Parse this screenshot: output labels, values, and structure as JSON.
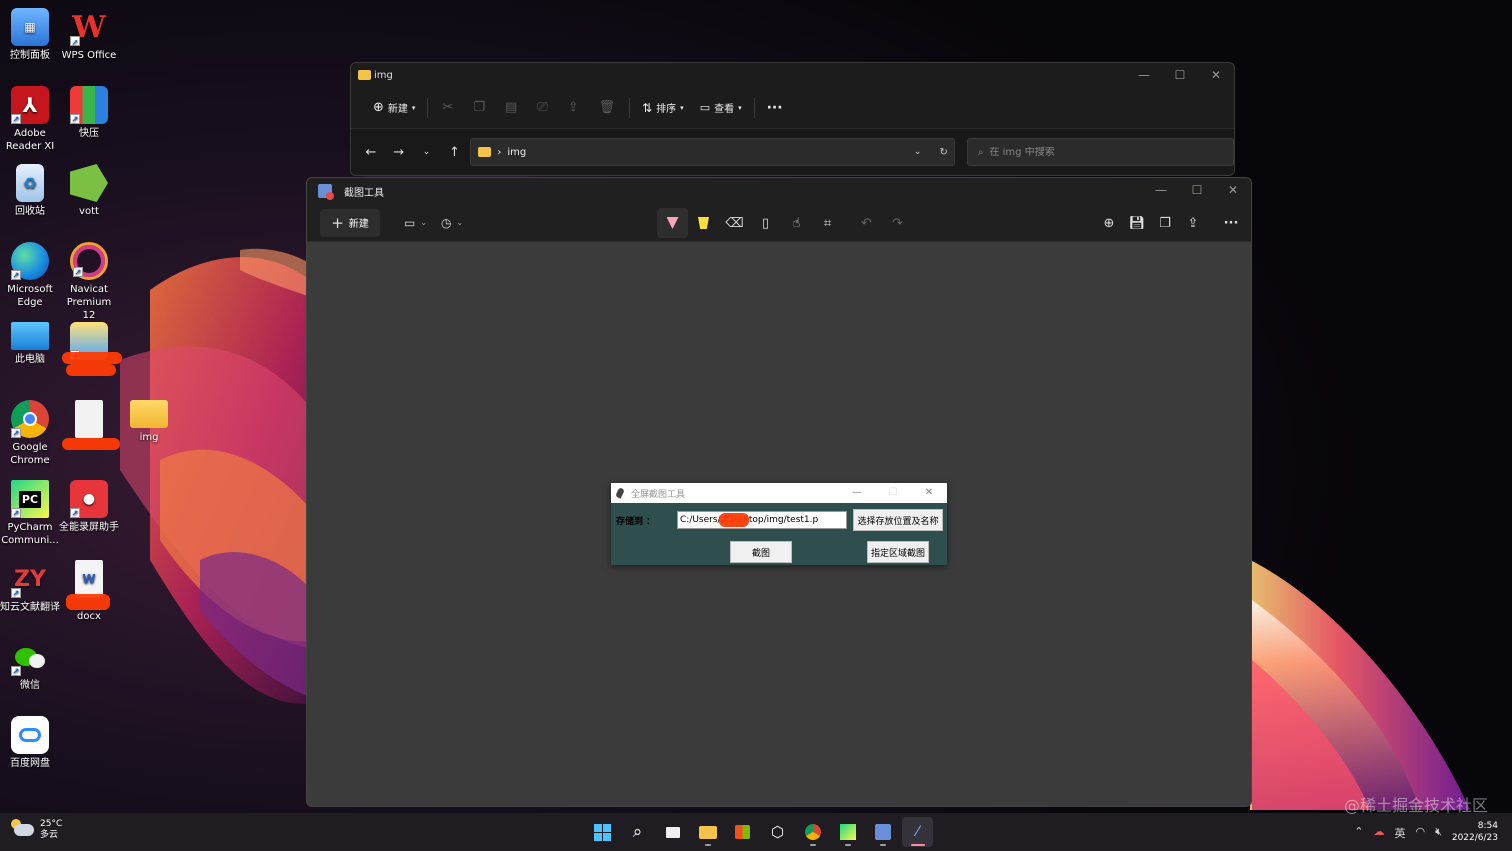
{
  "desktop": {
    "icons": [
      {
        "label": "控制面板"
      },
      {
        "label": "WPS Office"
      },
      {
        "label": "Adobe Reader XI"
      },
      {
        "label": "快压"
      },
      {
        "label": "回收站"
      },
      {
        "label": "vott"
      },
      {
        "label": "Microsoft Edge"
      },
      {
        "label": "Navicat Premium 12"
      },
      {
        "label": "此电脑"
      },
      {
        "label": "Google Chrome"
      },
      {
        "label": "img"
      },
      {
        "label": "PyCharm Communi..."
      },
      {
        "label": "全能录屏助手"
      },
      {
        "label": "知云文献翻译"
      },
      {
        "label": "docx"
      },
      {
        "label": "微信"
      },
      {
        "label": "百度网盘"
      }
    ]
  },
  "explorer": {
    "title": "img",
    "toolbar": {
      "new_label": "新建",
      "sort_label": "排序",
      "view_label": "查看",
      "more_label": "···"
    },
    "address": {
      "path_segment": "img"
    },
    "search": {
      "placeholder": "在 img 中搜索"
    }
  },
  "snip": {
    "title": "截图工具",
    "new_label": "新建"
  },
  "dialog": {
    "title": "全屏截图工具",
    "save_label": "存储到 ：",
    "path_value": "C:/Users/      /Desktop/img/test1.p",
    "choose_button": "选择存放位置及名称",
    "capture_button": "截图",
    "region_button": "指定区域截图"
  },
  "taskbar": {
    "weather_temp": "25°C",
    "weather_desc": "多云",
    "ime": "英",
    "time": "8:54",
    "date": "2022/6/23"
  },
  "watermark": "@稀土掘金技术社区",
  "colors": {
    "dialog_bg": "#2f4f4f",
    "accent_pen": "#f7a5b8",
    "highlighter": "#ffe03b",
    "folder": "#f4c44a"
  }
}
